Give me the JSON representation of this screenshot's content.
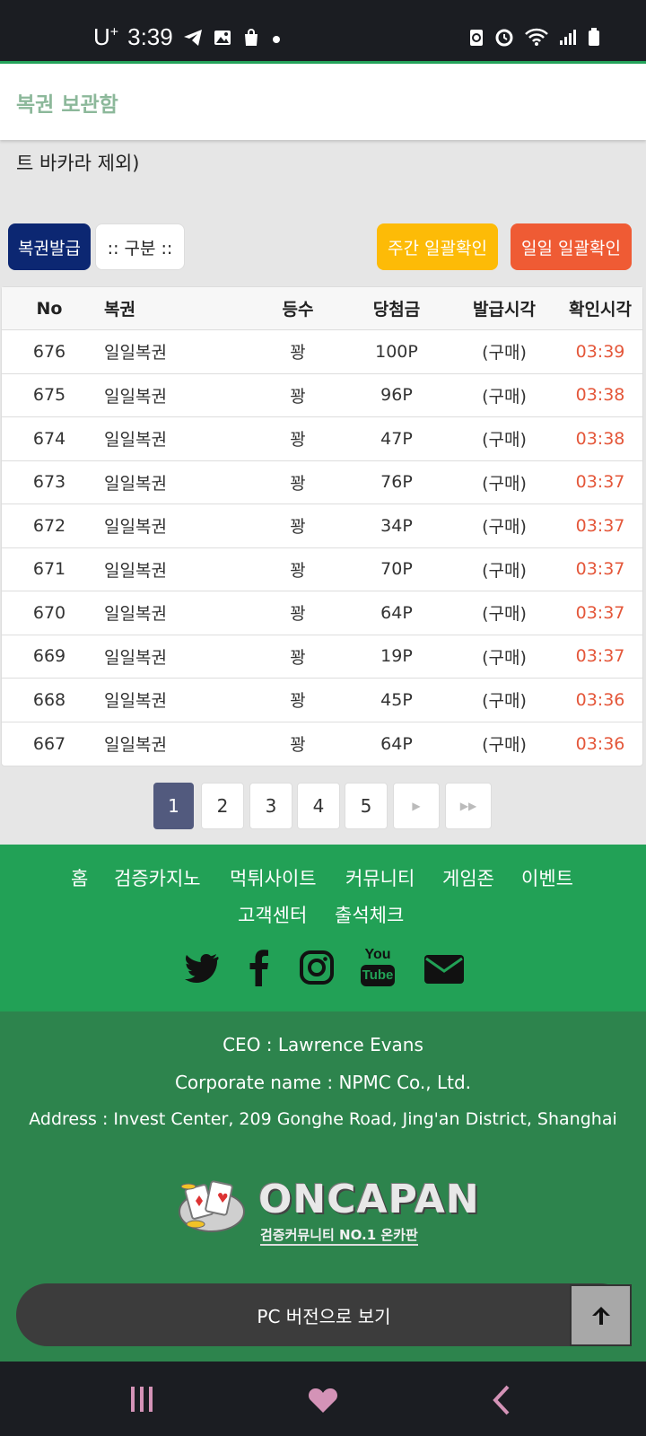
{
  "status_bar": {
    "carrier": "U",
    "carrier_sup": "+",
    "time": "3:39"
  },
  "header": {
    "title": "복권 보관함"
  },
  "notice_fragment": "트 바카라 제외)",
  "buttons": {
    "issue": "복권발급",
    "category": ":: 구분 ::",
    "weekly_check": "주간 일괄확인",
    "daily_check": "일일 일괄확인"
  },
  "table": {
    "headers": [
      "No",
      "복권",
      "등수",
      "당첨금",
      "발급시각",
      "확인시각"
    ],
    "rows": [
      {
        "no": "676",
        "name": "일일복권",
        "rank": "꽝",
        "prize": "100P",
        "issued": "(구매)",
        "checked": "03:39"
      },
      {
        "no": "675",
        "name": "일일복권",
        "rank": "꽝",
        "prize": "96P",
        "issued": "(구매)",
        "checked": "03:38"
      },
      {
        "no": "674",
        "name": "일일복권",
        "rank": "꽝",
        "prize": "47P",
        "issued": "(구매)",
        "checked": "03:38"
      },
      {
        "no": "673",
        "name": "일일복권",
        "rank": "꽝",
        "prize": "76P",
        "issued": "(구매)",
        "checked": "03:37"
      },
      {
        "no": "672",
        "name": "일일복권",
        "rank": "꽝",
        "prize": "34P",
        "issued": "(구매)",
        "checked": "03:37"
      },
      {
        "no": "671",
        "name": "일일복권",
        "rank": "꽝",
        "prize": "70P",
        "issued": "(구매)",
        "checked": "03:37"
      },
      {
        "no": "670",
        "name": "일일복권",
        "rank": "꽝",
        "prize": "64P",
        "issued": "(구매)",
        "checked": "03:37"
      },
      {
        "no": "669",
        "name": "일일복권",
        "rank": "꽝",
        "prize": "19P",
        "issued": "(구매)",
        "checked": "03:37"
      },
      {
        "no": "668",
        "name": "일일복권",
        "rank": "꽝",
        "prize": "45P",
        "issued": "(구매)",
        "checked": "03:36"
      },
      {
        "no": "667",
        "name": "일일복권",
        "rank": "꽝",
        "prize": "64P",
        "issued": "(구매)",
        "checked": "03:36"
      }
    ]
  },
  "pagination": {
    "pages": [
      "1",
      "2",
      "3",
      "4",
      "5"
    ],
    "current": "1",
    "next": "▶",
    "last": "▶▶"
  },
  "footer_nav": [
    "홈",
    "검증카지노",
    "먹튀사이트",
    "커뮤니티",
    "게임존",
    "이벤트",
    "고객센터",
    "출석체크"
  ],
  "social": [
    "twitter-icon",
    "facebook-icon",
    "instagram-icon",
    "youtube-icon",
    "email-icon"
  ],
  "youtube_text": {
    "top": "You",
    "bottom": "Tube"
  },
  "footer_info": {
    "ceo": "CEO : Lawrence Evans",
    "corporate": "Corporate name : NPMC Co., Ltd.",
    "address": "Address : Invest Center, 209 Gonghe Road, Jing'an District, Shanghai"
  },
  "logo": {
    "name": "ONCAPAN",
    "tagline": "검증커뮤니티 NO.1 온카판"
  },
  "pc_version": "PC 버전으로 보기",
  "colors": {
    "accent_green": "#22a156",
    "dark_green": "#2d844d",
    "navy": "#0c2772",
    "yellow": "#fdbb07",
    "orange": "#ef5b34",
    "time_red": "#e4573a"
  }
}
